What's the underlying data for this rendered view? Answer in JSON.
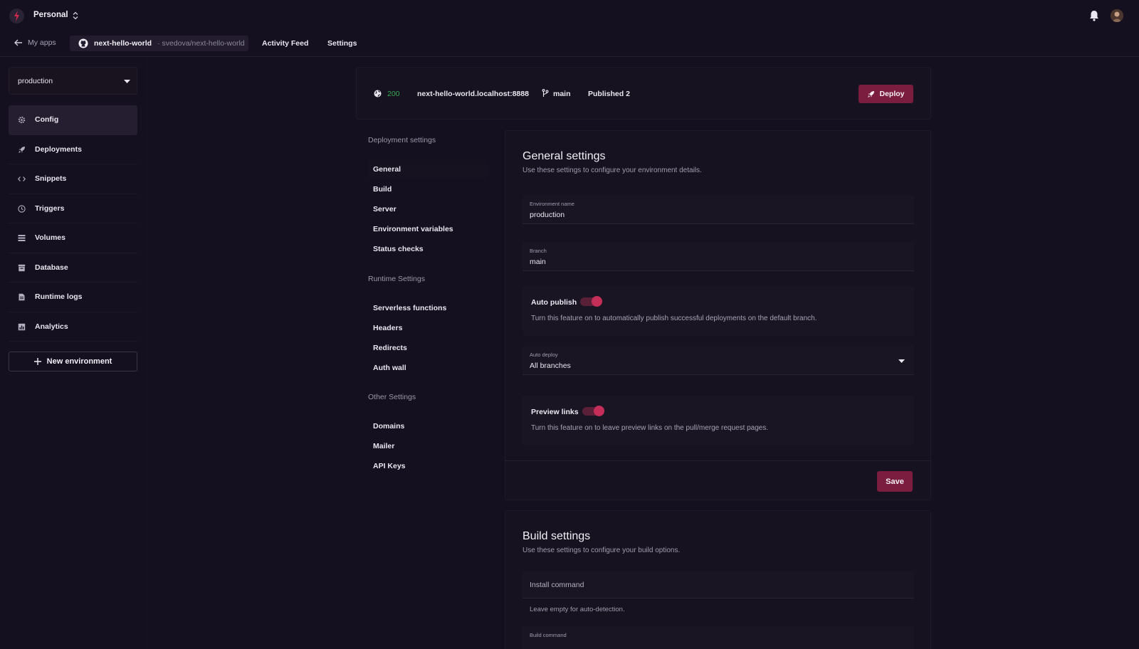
{
  "topbar": {
    "workspace": "Personal",
    "icons": [
      "app-logo-icon",
      "bell-icon",
      "avatar"
    ]
  },
  "nav": {
    "back_label": "My apps",
    "repo_name": "next-hello-world",
    "repo_path": "· svedova/next-hello-world",
    "activity_feed": "Activity Feed",
    "settings": "Settings"
  },
  "sidebar": {
    "environment": "production",
    "items": [
      {
        "label": "Config",
        "icon": "gear-icon"
      },
      {
        "label": "Deployments",
        "icon": "rocket-icon"
      },
      {
        "label": "Snippets",
        "icon": "code-icon"
      },
      {
        "label": "Triggers",
        "icon": "clock-icon"
      },
      {
        "label": "Volumes",
        "icon": "list-icon"
      },
      {
        "label": "Database",
        "icon": "database-icon"
      },
      {
        "label": "Runtime logs",
        "icon": "document-icon"
      },
      {
        "label": "Analytics",
        "icon": "chart-icon"
      }
    ],
    "new_environment": "New environment"
  },
  "status": {
    "code": "200",
    "host": "next-hello-world.localhost:8888",
    "branch": "main",
    "published": "Published  2",
    "deploy": "Deploy",
    "colors": {
      "ok": "#37a854",
      "accent": "#7a1d3f"
    }
  },
  "settings_nav": {
    "deployment_heading": "Deployment settings",
    "deployment_items": [
      "General",
      "Build",
      "Server",
      "Environment variables",
      "Status checks"
    ],
    "runtime_heading": "Runtime Settings",
    "runtime_items": [
      "Serverless functions",
      "Headers",
      "Redirects",
      "Auth wall"
    ],
    "other_heading": "Other Settings",
    "other_items": [
      "Domains",
      "Mailer",
      "API Keys"
    ]
  },
  "general": {
    "title": "General settings",
    "subtitle": "Use these settings to configure your environment details.",
    "env_name_label": "Environment name",
    "env_name_value": "production",
    "branch_label": "Branch",
    "branch_value": "main",
    "auto_publish_label": "Auto publish",
    "auto_publish_on": true,
    "auto_publish_desc": "Turn this feature on to automatically publish successful deployments on the default branch.",
    "auto_deploy_label": "Auto deploy",
    "auto_deploy_value": "All branches",
    "preview_links_label": "Preview links",
    "preview_links_on": true,
    "preview_links_desc": "Turn this feature on to leave preview links on the pull/merge request pages.",
    "save": "Save"
  },
  "build": {
    "title": "Build settings",
    "subtitle": "Use these settings to configure your build options.",
    "install_placeholder": "Install command",
    "install_hint": "Leave empty for auto-detection.",
    "build_command_label": "Build command"
  }
}
